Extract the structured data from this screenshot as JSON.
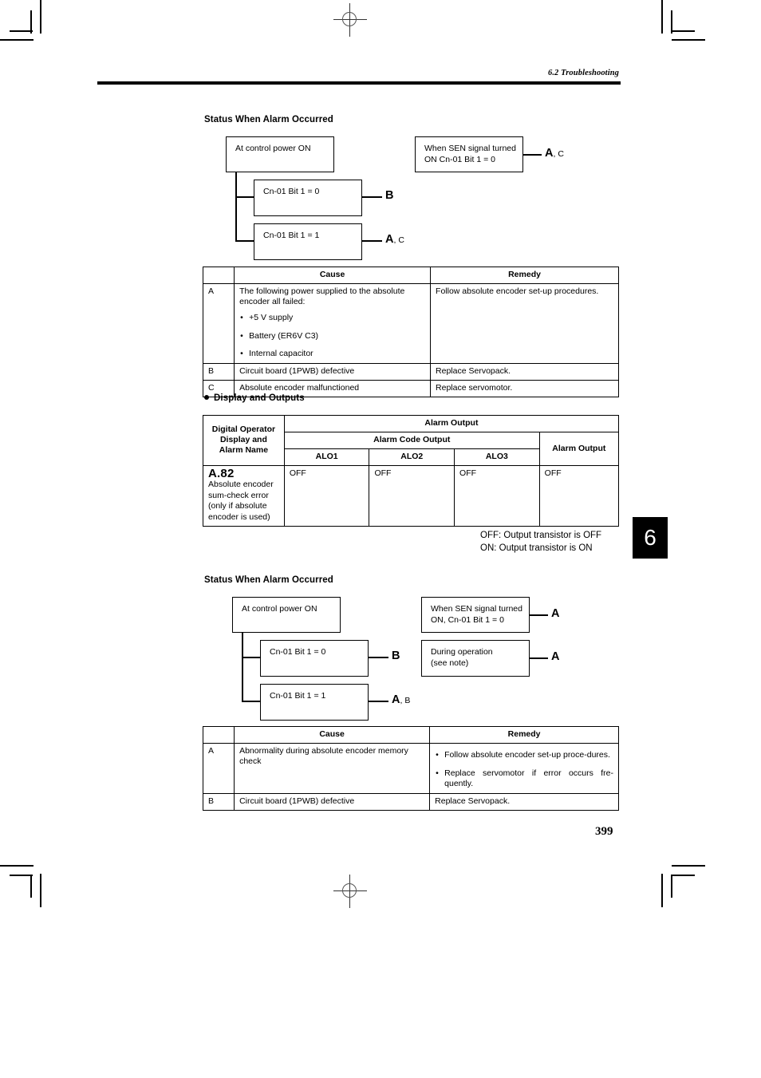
{
  "header": {
    "running_head": "6.2 Troubleshooting"
  },
  "page_number": "399",
  "chapter_tab": "6",
  "legend": "OFF: Output transistor is OFF\nON: Output transistor is ON",
  "section1": {
    "title": "Status When Alarm Occurred",
    "diagram": {
      "boxes": [
        {
          "id": "b1",
          "text": "At control power ON"
        },
        {
          "id": "b2",
          "text": "Cn-01 Bit 1 = 0"
        },
        {
          "id": "b3",
          "text": "Cn-01 Bit 1 = 1"
        },
        {
          "id": "b4",
          "text": "When SEN signal turned\nON Cn-01 Bit 1 = 0"
        }
      ],
      "labels": [
        {
          "id": "l1",
          "big": "B",
          "small": ""
        },
        {
          "id": "l2",
          "big": "A",
          "small": ", C"
        },
        {
          "id": "l3",
          "big": "A",
          "small": ", C"
        }
      ]
    },
    "cause_table": {
      "headers": [
        "",
        "Cause",
        "Remedy"
      ],
      "rows": [
        {
          "letter": "A",
          "cause_intro": "The following power supplied to the absolute encoder all failed:",
          "cause_bullets": [
            "+5 V supply",
            "Battery (ER6V C3)",
            "Internal capacitor"
          ],
          "remedy_text": "Follow absolute encoder set-up procedures.",
          "remedy_bullets": []
        },
        {
          "letter": "B",
          "cause_intro": "Circuit board (1PWB) defective",
          "cause_bullets": [],
          "remedy_text": "Replace Servopack.",
          "remedy_bullets": []
        },
        {
          "letter": "C",
          "cause_intro": "Absolute encoder malfunctioned",
          "cause_bullets": [],
          "remedy_text": "Replace servomotor.",
          "remedy_bullets": []
        }
      ]
    }
  },
  "section2": {
    "title": "Display and Outputs",
    "alarm_table": {
      "col1_header": "Digital Operator\nDisplay and\nAlarm Name",
      "group_header": "Alarm Output",
      "code_group_header": "Alarm Code Output",
      "alarm_output_header": "Alarm Output",
      "code_headers": [
        "ALO1",
        "ALO2",
        "ALO3"
      ],
      "row": {
        "alarm_code": "A.82",
        "alarm_desc": "Absolute encoder sum-check error (only if absolute encoder is used)",
        "alo1": "OFF",
        "alo2": "OFF",
        "alo3": "OFF",
        "alarm_output": "OFF"
      }
    }
  },
  "section3": {
    "title": "Status When Alarm Occurred",
    "diagram": {
      "boxes": [
        {
          "id": "b1",
          "text": "At control power ON"
        },
        {
          "id": "b2",
          "text": "Cn-01 Bit 1 = 0"
        },
        {
          "id": "b3",
          "text": "Cn-01 Bit 1 = 1"
        },
        {
          "id": "b4",
          "text": "When SEN signal turned\nON, Cn-01 Bit 1 = 0"
        },
        {
          "id": "b5",
          "text": "During operation\n(see note)"
        }
      ],
      "labels": [
        {
          "id": "l1",
          "big": "B",
          "small": ""
        },
        {
          "id": "l2",
          "big": "A",
          "small": ", B"
        },
        {
          "id": "l3",
          "big": "A",
          "small": ""
        },
        {
          "id": "l4",
          "big": "A",
          "small": ""
        }
      ]
    },
    "cause_table": {
      "headers": [
        "",
        "Cause",
        "Remedy"
      ],
      "rows": [
        {
          "letter": "A",
          "cause_intro": "Abnormality during absolute encoder memory check",
          "cause_bullets": [],
          "remedy_text": "",
          "remedy_bullets": [
            "Follow absolute encoder set-up proce-dures.",
            "Replace servomotor if error occurs fre-quently."
          ]
        },
        {
          "letter": "B",
          "cause_intro": "Circuit board (1PWB) defective",
          "cause_bullets": [],
          "remedy_text": "Replace Servopack.",
          "remedy_bullets": []
        }
      ]
    }
  }
}
